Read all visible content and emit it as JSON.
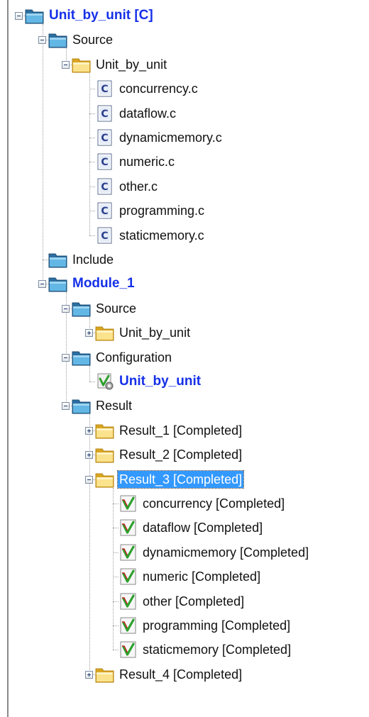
{
  "tree": [
    {
      "label": "Unit_by_unit [C]",
      "icon": "folder-blue",
      "bold": true,
      "expander": "minus"
    },
    {
      "label": "Source",
      "icon": "folder-blue",
      "expander": "minus"
    },
    {
      "label": "Unit_by_unit",
      "icon": "folder-yellow",
      "expander": "minus"
    },
    {
      "label": "concurrency.c",
      "icon": "c-file"
    },
    {
      "label": "dataflow.c",
      "icon": "c-file"
    },
    {
      "label": "dynamicmemory.c",
      "icon": "c-file"
    },
    {
      "label": "numeric.c",
      "icon": "c-file"
    },
    {
      "label": "other.c",
      "icon": "c-file"
    },
    {
      "label": "programming.c",
      "icon": "c-file"
    },
    {
      "label": "staticmemory.c",
      "icon": "c-file"
    },
    {
      "label": "Include",
      "icon": "folder-blue"
    },
    {
      "label": "Module_1",
      "icon": "folder-blue",
      "bold": true,
      "expander": "minus"
    },
    {
      "label": "Source",
      "icon": "folder-blue",
      "expander": "minus"
    },
    {
      "label": "Unit_by_unit",
      "icon": "folder-yellow",
      "expander": "plus"
    },
    {
      "label": "Configuration",
      "icon": "folder-blue",
      "expander": "minus"
    },
    {
      "label": "Unit_by_unit",
      "icon": "config-check",
      "bold": true
    },
    {
      "label": "Result",
      "icon": "folder-blue",
      "expander": "minus"
    },
    {
      "label": "Result_1 [Completed]",
      "icon": "folder-yellow",
      "expander": "plus"
    },
    {
      "label": "Result_2 [Completed]",
      "icon": "folder-yellow",
      "expander": "plus"
    },
    {
      "label": "Result_3 [Completed]",
      "icon": "folder-yellow",
      "expander": "minus",
      "selected": true
    },
    {
      "label": "concurrency [Completed]",
      "icon": "check-file"
    },
    {
      "label": "dataflow [Completed]",
      "icon": "check-file"
    },
    {
      "label": "dynamicmemory [Completed]",
      "icon": "check-file"
    },
    {
      "label": "numeric [Completed]",
      "icon": "check-file"
    },
    {
      "label": "other [Completed]",
      "icon": "check-file"
    },
    {
      "label": "programming [Completed]",
      "icon": "check-file"
    },
    {
      "label": "staticmemory [Completed]",
      "icon": "check-file"
    },
    {
      "label": "Result_4 [Completed]",
      "icon": "folder-yellow",
      "expander": "plus"
    }
  ]
}
